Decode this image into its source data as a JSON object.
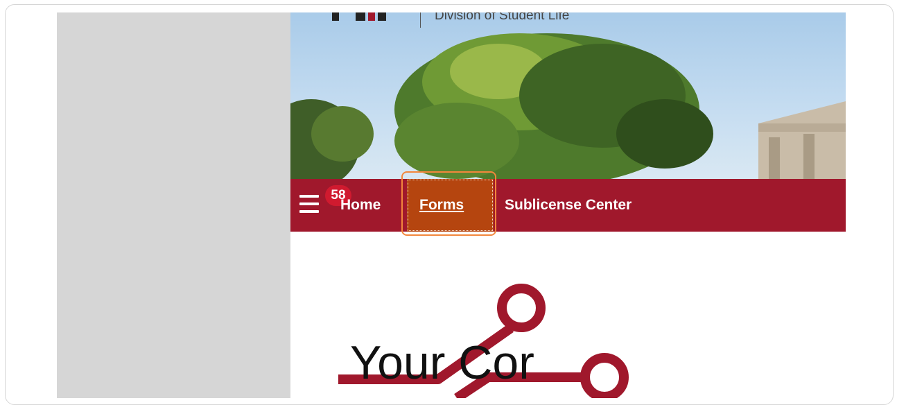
{
  "header": {
    "division_text": "Division of Student Life"
  },
  "nav": {
    "badge_count": "58",
    "items": [
      {
        "label": "Home"
      },
      {
        "label": "Forms",
        "active": true
      },
      {
        "label": "Sublicense Center"
      }
    ]
  },
  "content": {
    "heading_text": "Your Cor"
  },
  "colors": {
    "brand": "#a0182c",
    "active_nav": "#b5450f",
    "focus_ring": "#f2873c",
    "badge": "#d01a2f"
  },
  "icons": [
    "menu-icon",
    "logo-circuit-icon"
  ]
}
